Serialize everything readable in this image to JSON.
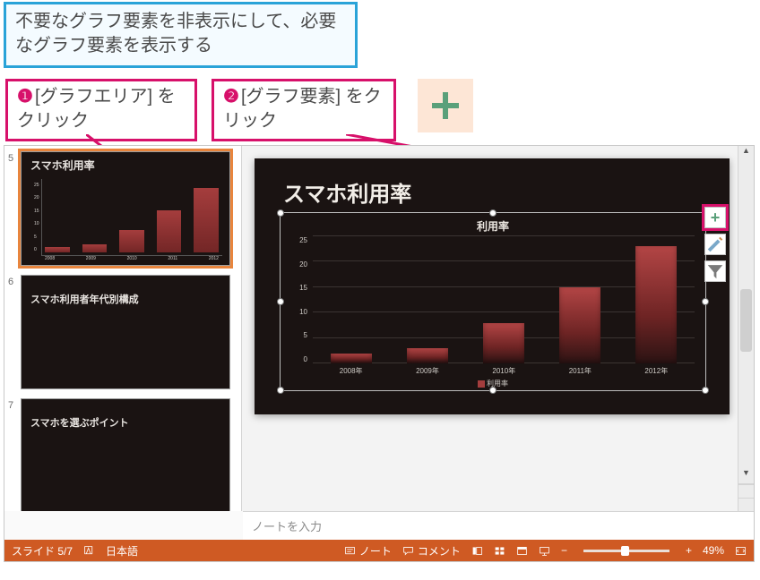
{
  "header_note": "不要なグラフ要素を非表示にして、必要なグラフ要素を表示する",
  "callouts": {
    "one_num": "❶",
    "one_text": "[グラフエリア] をクリック",
    "two_num": "❷",
    "two_text": "[グラフ要素] をクリック"
  },
  "thumbnails": [
    {
      "num": "5",
      "title": "スマホ利用率",
      "selected": true
    },
    {
      "num": "6",
      "title": "スマホ利用者年代別構成",
      "selected": false
    },
    {
      "num": "7",
      "title": "スマホを選ぶポイント",
      "selected": false
    }
  ],
  "slide": {
    "title": "スマホ利用率",
    "chart_title": "利用率",
    "legend": "利用率"
  },
  "notes_placeholder": "ノートを入力",
  "statusbar": {
    "slide_counter": "スライド 5/7",
    "language": "日本語",
    "notes_btn": "ノート",
    "comments_btn": "コメント",
    "zoom_minus": "−",
    "zoom_plus": "+",
    "zoom_pct": "49%"
  },
  "chart_data": {
    "type": "bar",
    "title": "利用率",
    "xlabel": "",
    "ylabel": "",
    "ylim": [
      0,
      25
    ],
    "y_ticks": [
      0,
      5,
      10,
      15,
      20,
      25
    ],
    "categories": [
      "2008年",
      "2009年",
      "2010年",
      "2011年",
      "2012年"
    ],
    "series": [
      {
        "name": "利用率",
        "values": [
          2,
          3,
          8,
          15,
          23
        ]
      }
    ]
  }
}
